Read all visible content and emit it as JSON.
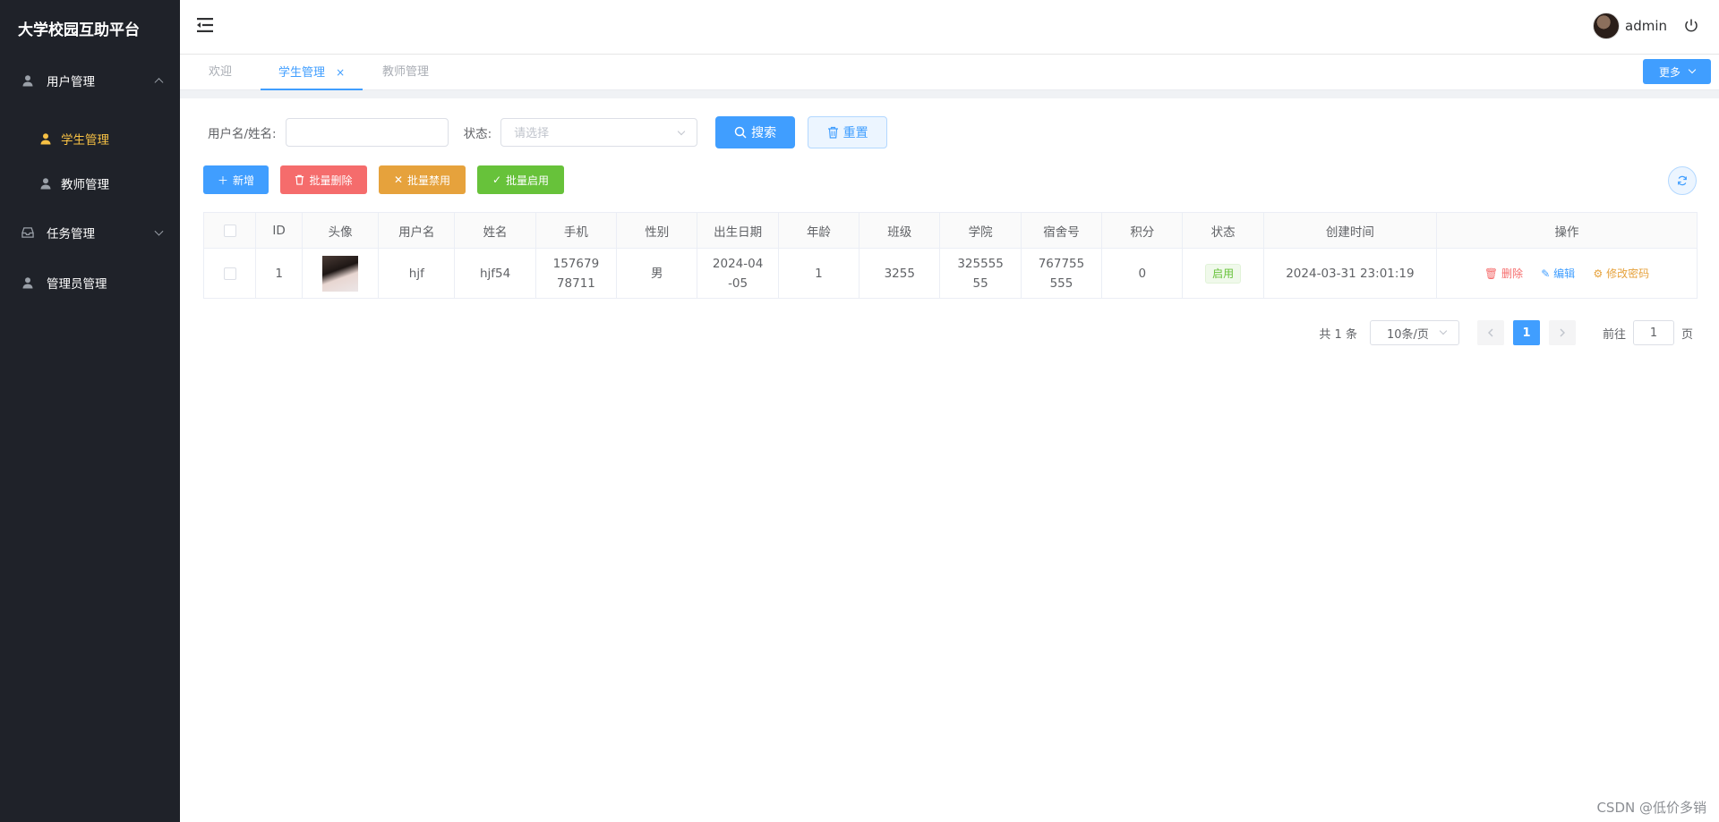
{
  "brand": "大学校园互助平台",
  "sidebar": {
    "items": [
      {
        "label": "用户管理"
      },
      {
        "label": "任务管理"
      },
      {
        "label": "管理员管理"
      }
    ],
    "sub_items": [
      {
        "label": "学生管理"
      },
      {
        "label": "教师管理"
      }
    ]
  },
  "header": {
    "user_name": "admin"
  },
  "tabs": [
    {
      "label": "欢迎"
    },
    {
      "label": "学生管理",
      "close": "×"
    },
    {
      "label": "教师管理"
    }
  ],
  "more_label": "更多",
  "search": {
    "name_label": "用户名/姓名:",
    "name_value": "",
    "status_label": "状态:",
    "status_placeholder": "请选择",
    "search_btn": "搜索",
    "reset_btn": "重置"
  },
  "actions": {
    "add": "新增",
    "batch_delete": "批量删除",
    "batch_disable": "批量禁用",
    "batch_enable": "批量启用"
  },
  "colors": {
    "primary": "#409eff",
    "danger": "#f56c6c",
    "warning": "#e6a23c",
    "success": "#67c23a",
    "sidebar_bg": "#1f2229",
    "active_menu": "#f7c144"
  },
  "table": {
    "headers": [
      "ID",
      "头像",
      "用户名",
      "姓名",
      "手机",
      "性别",
      "出生日期",
      "年龄",
      "班级",
      "学院",
      "宿舍号",
      "积分",
      "状态",
      "创建时间",
      "操作"
    ],
    "rows": [
      {
        "id": "1",
        "username": "hjf",
        "name": "hjf54",
        "phone_1": "157679",
        "phone_2": "78711",
        "gender": "男",
        "birth_1": "2024-04",
        "birth_2": "-05",
        "age": "1",
        "class": "3255",
        "college_1": "325555",
        "college_2": "55",
        "dorm_1": "767755",
        "dorm_2": "555",
        "points": "0",
        "status": "启用",
        "created": "2024-03-31 23:01:19",
        "op_delete": "删除",
        "op_edit": "编辑",
        "op_password": "修改密码"
      }
    ]
  },
  "pagination": {
    "total": "共 1 条",
    "page_size": "10条/页",
    "current": "1",
    "goto_prefix": "前往",
    "goto_value": "1",
    "goto_suffix": "页"
  },
  "watermark": "CSDN @低价多销"
}
